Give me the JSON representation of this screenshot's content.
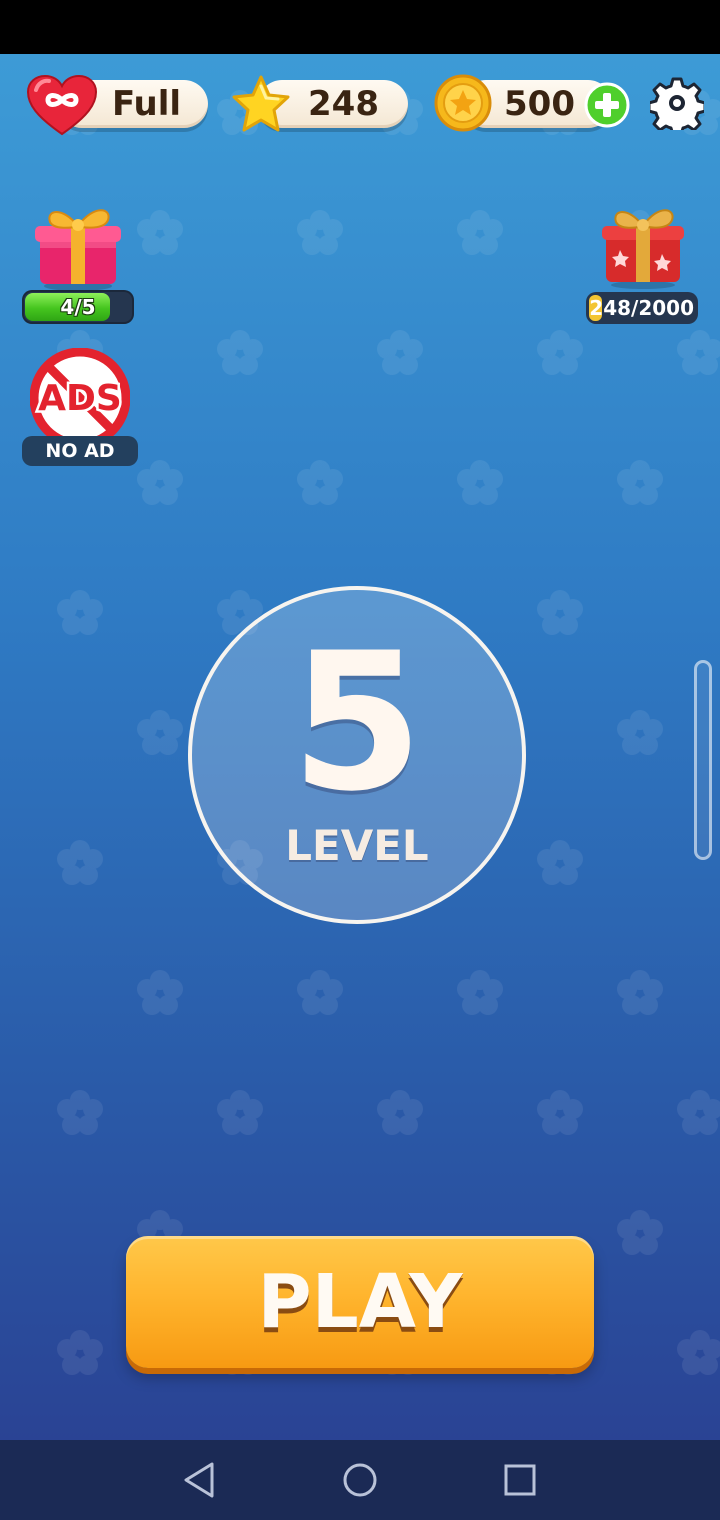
{
  "hud": {
    "lives": "Full",
    "stars": "248",
    "coins": "500"
  },
  "left_gift": {
    "progress_text": "4/5",
    "progress_fraction": 0.8
  },
  "no_ads": {
    "badge_text": "ADS",
    "label": "NO AD"
  },
  "right_gift": {
    "counter_text": "248/2000",
    "progress_fraction": 0.124
  },
  "level": {
    "number": "5",
    "label": "LEVEL"
  },
  "play": {
    "label": "PLAY"
  },
  "colors": {
    "background_top": "#3d9bd6",
    "background_bottom": "#2a4394",
    "play_button": "#ffb52e",
    "progress_green": "#45c51f",
    "nav_bar": "#1b2a55"
  },
  "icons": [
    "heart-infinity-icon",
    "star-icon",
    "coin-icon",
    "plus-icon",
    "gear-icon",
    "gift-icon",
    "no-ads-icon",
    "star-gift-icon",
    "back-icon",
    "home-icon",
    "recents-icon"
  ]
}
